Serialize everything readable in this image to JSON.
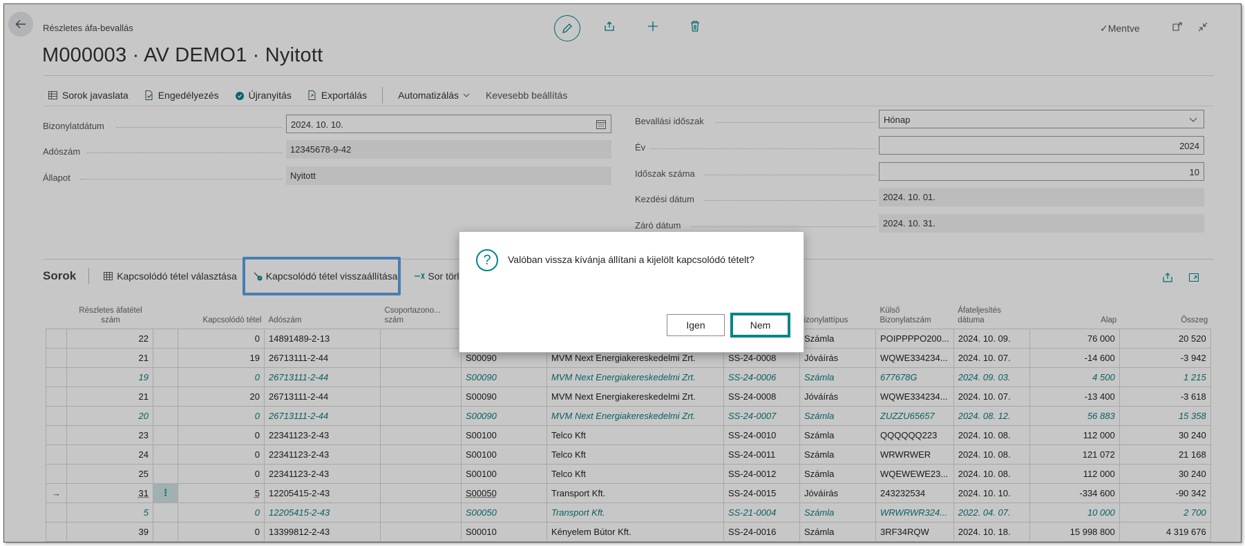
{
  "header": {
    "breadcrumb": "Részletes áfa-bevallás",
    "title": "M000003 · AV DEMO1 · Nyitott",
    "saved_status": "Mentve"
  },
  "actions": {
    "suggest_lines": "Sorok javaslata",
    "approve": "Engedélyezés",
    "reopen": "Újranyitás",
    "export": "Exportálás",
    "automate": "Automatizálás",
    "fewer_options": "Kevesebb beállítás"
  },
  "form": {
    "doc_date_label": "Bizonylatdátum",
    "doc_date_value": "2024. 10. 10.",
    "tax_no_label": "Adószám",
    "tax_no_value": "12345678-9-42",
    "status_label": "Állapot",
    "status_value": "Nyitott",
    "period_label": "Bevallási időszak",
    "period_value": "Hónap",
    "year_label": "Év",
    "year_value": "2024",
    "period_no_label": "Időszak száma",
    "period_no_value": "10",
    "start_date_label": "Kezdési dátum",
    "start_date_value": "2024. 10. 01.",
    "end_date_label": "Záró dátum",
    "end_date_value": "2024. 10. 31."
  },
  "lines": {
    "title": "Sorok",
    "select_related": "Kapcsolódó tétel választása",
    "restore_related": "Kapcsolódó tétel visszaállítása",
    "delete_row": "Sor törlés",
    "columns": {
      "detail_no": "Részletes áfatétel szám",
      "related": "Kapcsolódó tétel",
      "tax_no": "Adószám",
      "group_no": "Csoportazono... szám",
      "doc_type": "izonylattípus",
      "ext_doc_no": "Külső Bizonylatszám",
      "perf_date": "Áfateljesítés dátuma",
      "base": "Alap",
      "amount": "Összeg"
    },
    "rows": [
      {
        "arrow": "",
        "detail": "22",
        "related": "0",
        "tax": "14891489-2-13",
        "group": "",
        "cust": "",
        "name": "",
        "doc": "",
        "type": "Számla",
        "ext": "POIPPPPO200...",
        "date": "2024. 10. 09.",
        "base": "76 000",
        "amount": "20 520",
        "italic": false
      },
      {
        "arrow": "",
        "detail": "21",
        "related": "19",
        "tax": "26713111-2-44",
        "group": "",
        "cust": "S00090",
        "name": "MVM Next Energiakereskedelmi Zrt.",
        "doc": "SS-24-0008",
        "type": "Jóváírás",
        "ext": "WQWE334234...",
        "date": "2024. 10. 07.",
        "base": "-14 600",
        "amount": "-3 942",
        "italic": false
      },
      {
        "arrow": "",
        "detail": "19",
        "related": "0",
        "tax": "26713111-2-44",
        "group": "",
        "cust": "S00090",
        "name": "MVM Next Energiakereskedelmi Zrt.",
        "doc": "SS-24-0006",
        "type": "Számla",
        "ext": "677678G",
        "date": "2024. 09. 03.",
        "base": "4 500",
        "amount": "1 215",
        "italic": true
      },
      {
        "arrow": "",
        "detail": "21",
        "related": "20",
        "tax": "26713111-2-44",
        "group": "",
        "cust": "S00090",
        "name": "MVM Next Energiakereskedelmi Zrt.",
        "doc": "SS-24-0008",
        "type": "Jóváírás",
        "ext": "WQWE334234...",
        "date": "2024. 10. 07.",
        "base": "-13 400",
        "amount": "-3 618",
        "italic": false
      },
      {
        "arrow": "",
        "detail": "20",
        "related": "0",
        "tax": "26713111-2-44",
        "group": "",
        "cust": "S00090",
        "name": "MVM Next Energiakereskedelmi Zrt.",
        "doc": "SS-24-0007",
        "type": "Számla",
        "ext": "ZUZZU65657",
        "date": "2024. 08. 12.",
        "base": "56 883",
        "amount": "15 358",
        "italic": true
      },
      {
        "arrow": "",
        "detail": "23",
        "related": "0",
        "tax": "22341123-2-43",
        "group": "",
        "cust": "S00100",
        "name": "Telco Kft",
        "doc": "SS-24-0010",
        "type": "Számla",
        "ext": "QQQQQQ223",
        "date": "2024. 10. 08.",
        "base": "112 000",
        "amount": "30 240",
        "italic": false
      },
      {
        "arrow": "",
        "detail": "24",
        "related": "0",
        "tax": "22341123-2-43",
        "group": "",
        "cust": "S00100",
        "name": "Telco Kft",
        "doc": "SS-24-0011",
        "type": "Számla",
        "ext": "WRWRWER",
        "date": "2024. 10. 08.",
        "base": "121 072",
        "amount": "21 168",
        "italic": false
      },
      {
        "arrow": "",
        "detail": "25",
        "related": "0",
        "tax": "22341123-2-43",
        "group": "",
        "cust": "S00100",
        "name": "Telco Kft",
        "doc": "SS-24-0012",
        "type": "Számla",
        "ext": "WQEWEWE23...",
        "date": "2024. 10. 08.",
        "base": "112 000",
        "amount": "30 240",
        "italic": false
      },
      {
        "arrow": "→",
        "detail": "31",
        "related": "5",
        "tax": "12205415-2-43",
        "group": "",
        "cust": "S00050",
        "name": "Transport Kft.",
        "doc": "SS-24-0015",
        "type": "Jóváírás",
        "ext": "243232534",
        "date": "2024. 10. 10.",
        "base": "-334 600",
        "amount": "-90 342",
        "italic": false
      },
      {
        "arrow": "",
        "detail": "5",
        "related": "0",
        "tax": "12205415-2-43",
        "group": "",
        "cust": "S00050",
        "name": "Transport Kft.",
        "doc": "SS-21-0004",
        "type": "Számla",
        "ext": "WRWRWR324...",
        "date": "2022. 04. 07.",
        "base": "10 000",
        "amount": "2 700",
        "italic": true
      },
      {
        "arrow": "",
        "detail": "39",
        "related": "0",
        "tax": "13399812-2-43",
        "group": "",
        "cust": "S00010",
        "name": "Kényelem Bútor Kft.",
        "doc": "SS-24-0016",
        "type": "Számla",
        "ext": "3RF34RQW",
        "date": "2024. 10. 18.",
        "base": "15 998 800",
        "amount": "4 319 676",
        "italic": false
      }
    ]
  },
  "dialog": {
    "question": "Valóban vissza kívánja állítani a kijelölt kapcsolódó tételt?",
    "yes": "Igen",
    "no": "Nem"
  }
}
